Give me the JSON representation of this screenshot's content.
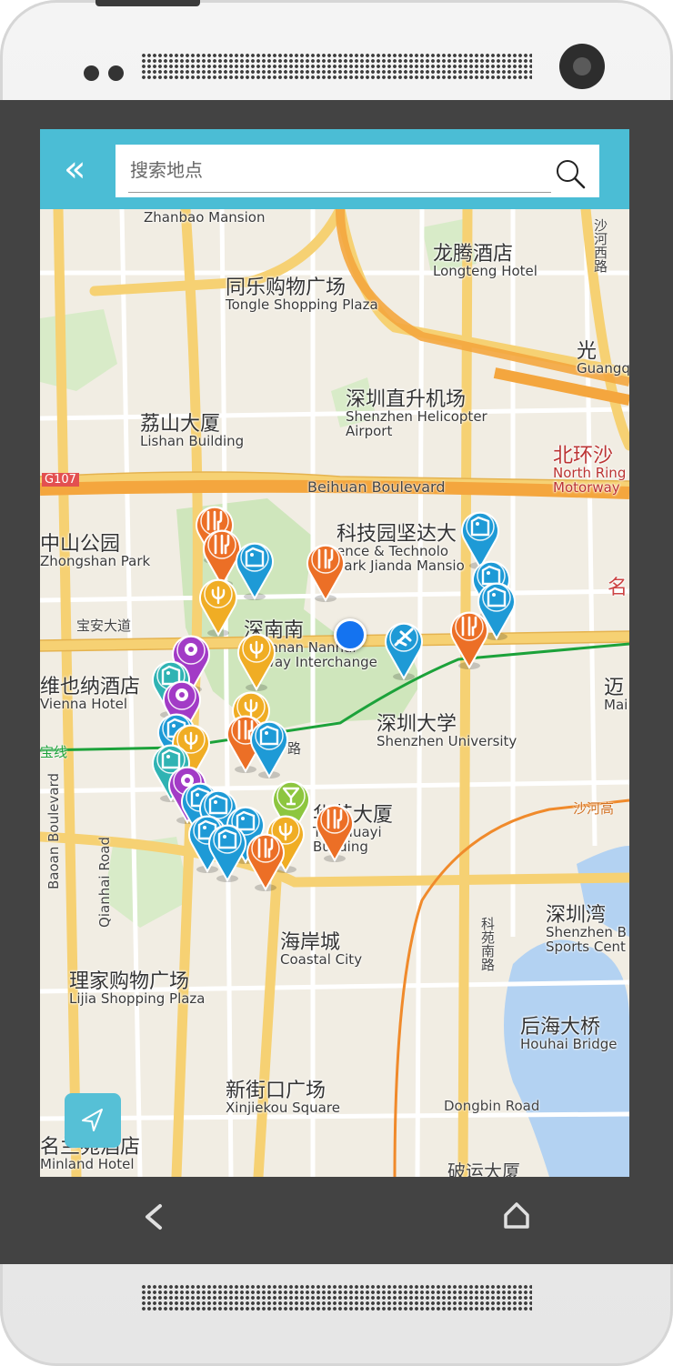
{
  "search": {
    "back_icon_glyph": "«",
    "placeholder": "搜索地点",
    "value": ""
  },
  "colors": {
    "header": "#4bbdd5",
    "pin_orange": "#ec6f26",
    "pin_blue": "#1e9ad6",
    "pin_yellow": "#f0ad24",
    "pin_purple": "#a23bc6",
    "pin_teal": "#2fb3b3",
    "pin_green": "#8dc63f",
    "my_location": "#1473f0"
  },
  "map": {
    "places": [
      {
        "zh": "",
        "en": "Zhanbao Mansion"
      },
      {
        "zh": "龙腾酒店",
        "en": "Longteng Hotel"
      },
      {
        "zh": "同乐购物广场",
        "en": "Tongle Shopping Plaza"
      },
      {
        "zh": "光",
        "en": "Guangq"
      },
      {
        "zh": "深圳直升机场",
        "en": "Shenzhen Helicopter Airport"
      },
      {
        "zh": "荔山大厦",
        "en": "Lishan Building"
      },
      {
        "zh": "北环沙",
        "en": "North Ring Motorway"
      },
      {
        "zh": "科技园坚达大",
        "en": "ence & Technolo Park Jianda Mansio"
      },
      {
        "zh": "中山公园",
        "en": "Zhongshan Park"
      },
      {
        "zh": "深南南",
        "en": "Shennan Nanhai Flyway Interchange"
      },
      {
        "zh": "维也纳酒店",
        "en": "Vienna Hotel"
      },
      {
        "zh": "深圳大学",
        "en": "Shenzhen University"
      },
      {
        "zh": "华艺大厦",
        "en": "The Huayi Building"
      },
      {
        "zh": "深圳湾",
        "en": "Shenzhen B Sports Cent"
      },
      {
        "zh": "海岸城",
        "en": "Coastal City"
      },
      {
        "zh": "理家购物广场",
        "en": "Lijia Shopping Plaza"
      },
      {
        "zh": "后海大桥",
        "en": "Houhai Bridge"
      },
      {
        "zh": "新街口广场",
        "en": "Xinjiekou Square"
      },
      {
        "zh": "名兰苑酒店",
        "en": "Minland Hotel"
      },
      {
        "zh": "迈",
        "en": "Mai"
      },
      {
        "zh": "名",
        "en": ""
      }
    ],
    "roads": [
      "Beihuan Boulevard",
      "G107",
      "宝安大道",
      "沙河西路",
      "沙河高",
      "Dongbin Road",
      "科苑南路",
      "Qianhai Road",
      "Baoan Boulevard",
      "宝线",
      "路",
      "破运大厦"
    ],
    "pins": [
      {
        "type": "restaurant",
        "color": "orange"
      },
      {
        "type": "restaurant",
        "color": "orange"
      },
      {
        "type": "shop",
        "color": "blue"
      },
      {
        "type": "hotel",
        "color": "yellow"
      },
      {
        "type": "restaurant",
        "color": "orange"
      },
      {
        "type": "shop",
        "color": "blue"
      },
      {
        "type": "shop",
        "color": "blue"
      },
      {
        "type": "shop",
        "color": "blue"
      },
      {
        "type": "airport",
        "color": "blue"
      },
      {
        "type": "restaurant",
        "color": "orange"
      },
      {
        "type": "hotel",
        "color": "yellow"
      },
      {
        "type": "beauty",
        "color": "purple"
      },
      {
        "type": "shop",
        "color": "teal"
      },
      {
        "type": "beauty",
        "color": "purple"
      },
      {
        "type": "hotel",
        "color": "yellow"
      },
      {
        "type": "shop",
        "color": "blue"
      },
      {
        "type": "restaurant",
        "color": "orange"
      },
      {
        "type": "shop",
        "color": "blue"
      },
      {
        "type": "hotel",
        "color": "yellow"
      },
      {
        "type": "shop",
        "color": "teal"
      },
      {
        "type": "beauty",
        "color": "purple"
      },
      {
        "type": "bar",
        "color": "green"
      },
      {
        "type": "shop",
        "color": "blue"
      },
      {
        "type": "shop",
        "color": "blue"
      },
      {
        "type": "shop",
        "color": "blue"
      },
      {
        "type": "hotel",
        "color": "yellow"
      },
      {
        "type": "restaurant",
        "color": "orange"
      },
      {
        "type": "restaurant",
        "color": "orange"
      },
      {
        "type": "shop",
        "color": "blue"
      },
      {
        "type": "shop",
        "color": "blue"
      }
    ]
  },
  "icons": {
    "back": "double-chevron-left-icon",
    "search": "search-icon",
    "locate": "location-arrow-icon",
    "nav_back": "back-arrow-icon",
    "nav_home": "home-icon"
  }
}
